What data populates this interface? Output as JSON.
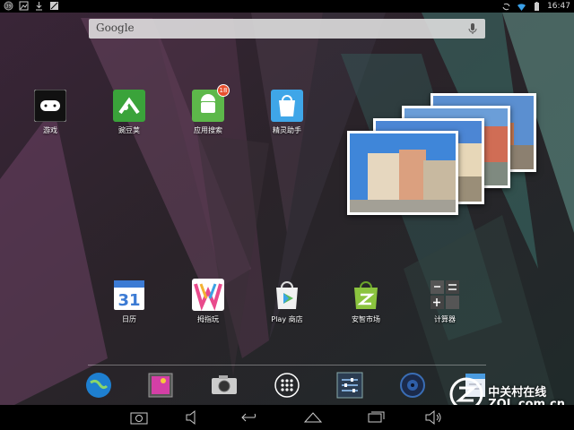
{
  "status_bar": {
    "time": "16:47",
    "notification_icons": [
      "notification-badge-icon",
      "image-icon",
      "download-icon",
      "no-sim-icon"
    ],
    "system_icons": [
      "sync-icon",
      "wifi-icon",
      "battery-icon"
    ]
  },
  "search": {
    "label": "Google",
    "icon": "mic-icon"
  },
  "top_apps": [
    {
      "label": "游戏",
      "icon": "gamepad-icon"
    },
    {
      "label": "豌豆荚",
      "icon": "wandoujia-icon"
    },
    {
      "label": "应用搜索",
      "icon": "android-icon",
      "badge": "18"
    },
    {
      "label": "精灵助手",
      "icon": "shopping-bag-icon"
    }
  ],
  "bottom_apps": [
    {
      "label": "日历",
      "icon": "calendar-icon",
      "day": "31"
    },
    {
      "label": "拇指玩",
      "icon": "w-logo-icon"
    },
    {
      "label": "Play 商店",
      "icon": "play-store-icon"
    },
    {
      "label": "安智市场",
      "icon": "anzhi-icon"
    },
    {
      "label": "计算器",
      "icon": "calculator-icon"
    }
  ],
  "dock": [
    "browser-icon",
    "gallery-icon",
    "camera-icon",
    "app-drawer-icon",
    "settings-icon",
    "music-icon",
    "file-manager-icon"
  ],
  "nav": [
    "screenshot-icon",
    "volume-down-icon",
    "back-icon",
    "home-icon",
    "recents-icon",
    "volume-up-icon"
  ],
  "watermark": {
    "line1": "中关村在线",
    "line2": "ZOL.com.cn"
  },
  "colors": {
    "status_bar": "#000000",
    "search_bg": "#e1e1e1",
    "badge": "#e8502e",
    "wandoujia": "#3aa33a",
    "android": "#5db84a",
    "bag": "#3fa6e8"
  }
}
